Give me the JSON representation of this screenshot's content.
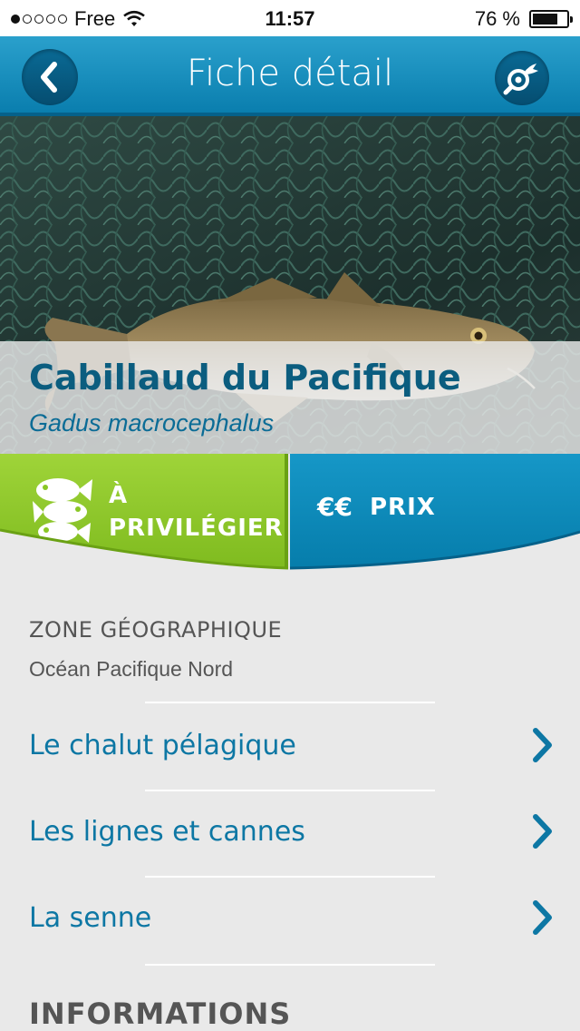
{
  "status_bar": {
    "carrier": "Free",
    "time": "11:57",
    "battery": "76 %",
    "battery_level": 0.76,
    "signal_dots_filled": 1,
    "signal_dots_total": 5
  },
  "navbar": {
    "title": "Fiche détail",
    "back_icon": "chevron-left-icon",
    "search_icon": "fish-search-icon"
  },
  "species": {
    "common_name": "Cabillaud du Pacifique",
    "latin_name": "Gadus macrocephalus"
  },
  "tabs": {
    "recommendation_line1": "À",
    "recommendation_line2": "PRIVILÉGIER",
    "price_symbol": "€€",
    "price_label": "PRIX"
  },
  "zone": {
    "title": "ZONE GÉOGRAPHIQUE",
    "value": "Océan Pacifique Nord"
  },
  "methods": [
    {
      "label": "Le chalut pélagique"
    },
    {
      "label": "Les lignes et cannes"
    },
    {
      "label": "La senne"
    }
  ],
  "informations_title": "INFORMATIONS",
  "colors": {
    "brand_blue": "#0a7eae",
    "green": "#8ac726",
    "text_blue": "#0d77a4"
  }
}
